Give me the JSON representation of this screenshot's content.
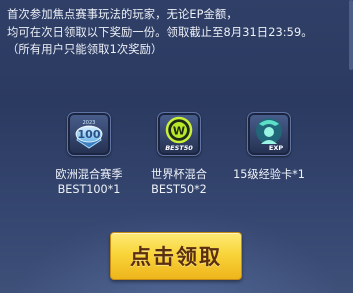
{
  "notice": {
    "line1": "首次参加焦点赛事玩法的玩家，无论EP金额，",
    "line2": "均可在次日领取以下奖励一份。领取截止至8月31日23:59。",
    "line3": "（所有用户只能领取1次奖励）"
  },
  "rewards": [
    {
      "icon": "trophy-100-badge-icon",
      "icon_text": "100",
      "label_line1": "欧洲混合赛季",
      "label_line2": "BEST100*1"
    },
    {
      "icon": "w-best50-badge-icon",
      "icon_text": "W",
      "icon_subtext": "BEST50",
      "label_line1": "世界杯混合",
      "label_line2": "BEST50*2"
    },
    {
      "icon": "exp-card-icon",
      "icon_text": "EXP",
      "label_line1": "15级经验卡*1",
      "label_line2": ""
    }
  ],
  "claim_button": {
    "label": "点击领取"
  },
  "colors": {
    "background": "#2f3f67",
    "button": "#f8d53a",
    "button_text": "#5a2e10"
  }
}
